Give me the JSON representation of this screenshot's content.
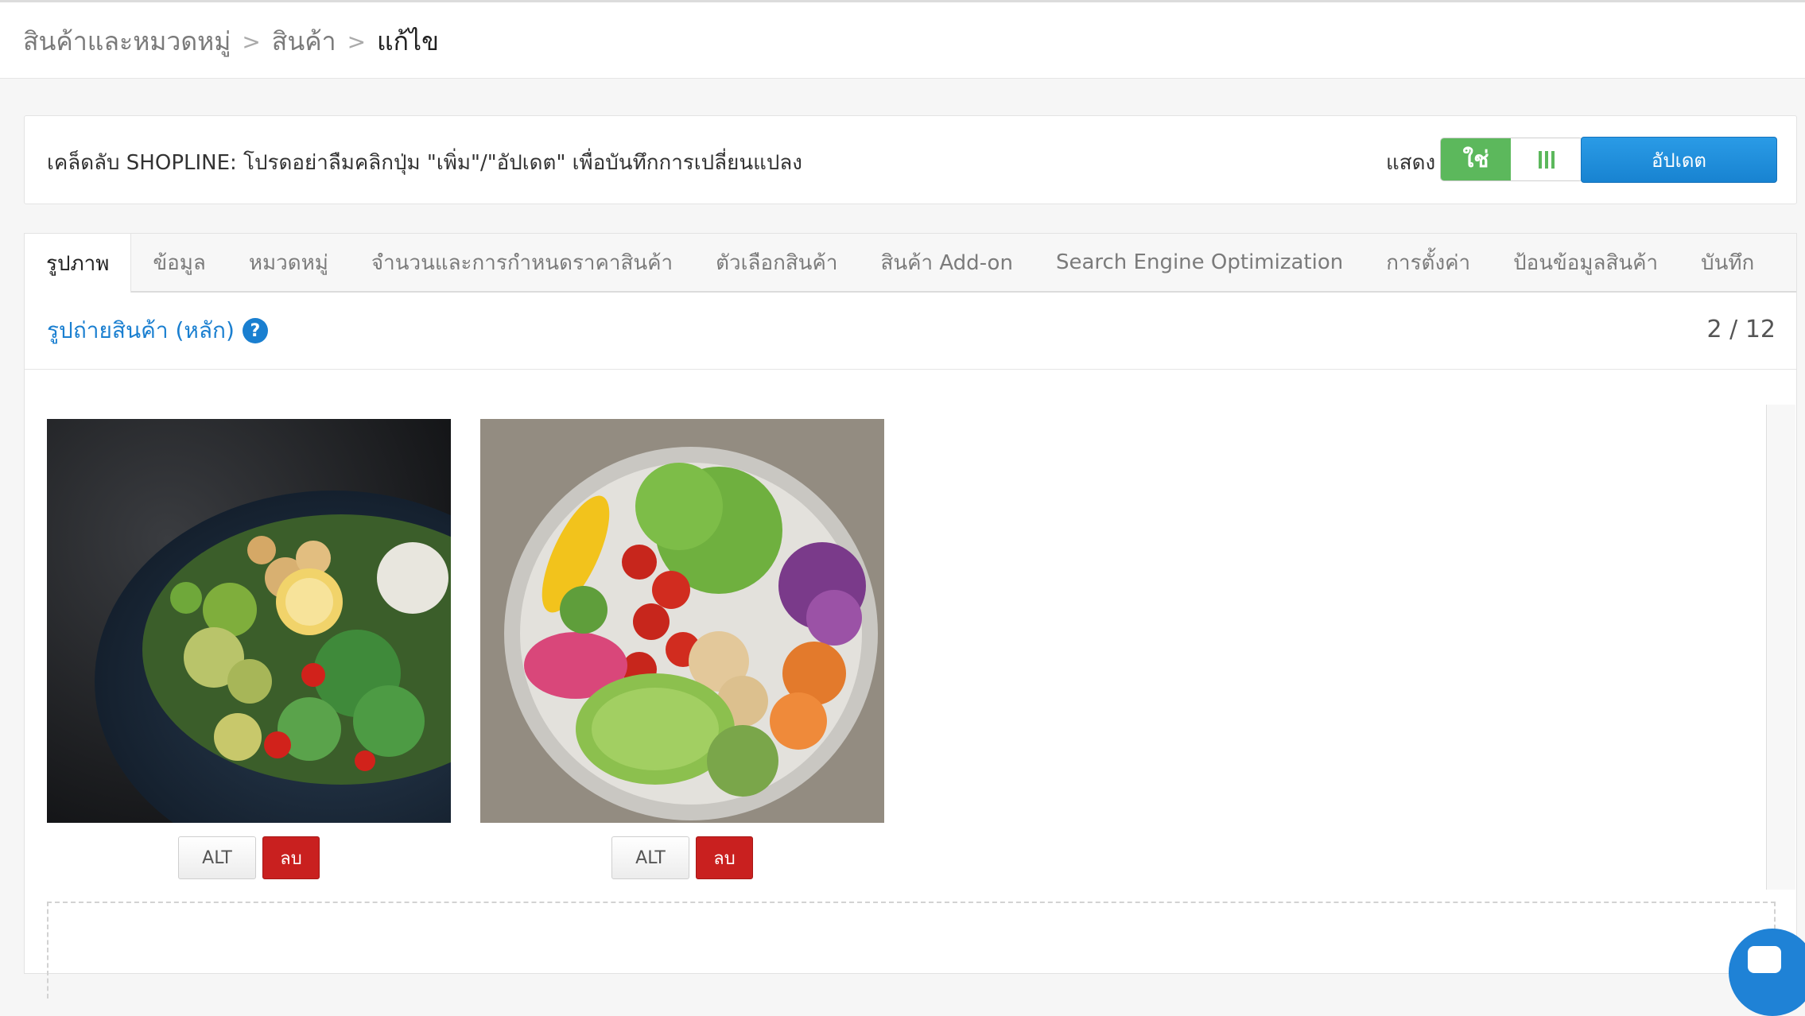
{
  "breadcrumb": {
    "items": [
      "สินค้าและหมวดหมู่",
      "สินค้า"
    ],
    "current": "แก้ไข",
    "separator": ">"
  },
  "tip": {
    "text": "เคล็ดลับ SHOPLINE: โปรดอย่าลืมคลิกปุ่ม \"เพิ่ม\"/\"อัปเดต\" เพื่อบันทึกการเปลี่ยนแปลง",
    "show_label": "แสดง",
    "toggle_yes": "ใช่",
    "toggle_state": "on",
    "update_button": "อัปเดต"
  },
  "tabs": [
    {
      "label": "รูปภาพ",
      "active": true
    },
    {
      "label": "ข้อมูล",
      "active": false
    },
    {
      "label": "หมวดหมู่",
      "active": false
    },
    {
      "label": "จำนวนและการกำหนดราคาสินค้า",
      "active": false
    },
    {
      "label": "ตัวเลือกสินค้า",
      "active": false
    },
    {
      "label": "สินค้า Add-on",
      "active": false
    },
    {
      "label": "Search Engine Optimization",
      "active": false
    },
    {
      "label": "การตั้งค่า",
      "active": false
    },
    {
      "label": "ป้อนข้อมูลสินค้า",
      "active": false
    },
    {
      "label": "บันทึก",
      "active": false
    }
  ],
  "images_section": {
    "title": "รูปถ่ายสินค้า (หลัก)",
    "help_icon": "?",
    "count": "2 / 12",
    "images": [
      {
        "description": "salad bowl photo 1",
        "alt_label": "ALT",
        "delete_label": "ลบ"
      },
      {
        "description": "salad bowl photo 2",
        "alt_label": "ALT",
        "delete_label": "ลบ"
      }
    ]
  },
  "colors": {
    "primary_blue": "#1a7fd0",
    "success_green": "#5cb85c",
    "danger_red": "#c9201f"
  }
}
